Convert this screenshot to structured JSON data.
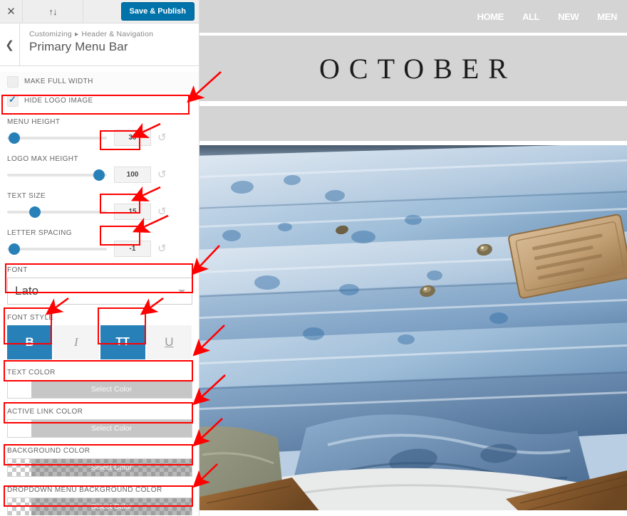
{
  "toolbar": {
    "close_icon": "close-x-icon",
    "devices_icon": "device-preview-icon",
    "save_label": "Save & Publish",
    "accent_color": "#0073aa"
  },
  "header": {
    "back_icon": "chevron-left-icon",
    "breadcrumb_root": "Customizing",
    "breadcrumb_separator": "▸",
    "breadcrumb_parent": "Header & Navigation",
    "title": "Primary Menu Bar"
  },
  "controls": {
    "make_full_width": {
      "label": "Make Full Width",
      "checked": false
    },
    "hide_logo_image": {
      "label": "Hide Logo Image",
      "checked": true
    },
    "menu_height": {
      "label": "Menu Height",
      "value": "30",
      "percent": 7
    },
    "logo_max_height": {
      "label": "Logo Max Height",
      "value": "100",
      "percent": 92
    },
    "text_size": {
      "label": "Text Size",
      "value": "15",
      "percent": 28
    },
    "letter_spacing": {
      "label": "Letter Spacing",
      "value": "-1",
      "percent": 7
    },
    "font": {
      "label": "Font",
      "value": "Lato"
    },
    "font_style": {
      "label": "Font Style",
      "buttons": [
        {
          "name": "bold",
          "glyph": "B",
          "active": true
        },
        {
          "name": "italic",
          "glyph": "I",
          "active": false
        },
        {
          "name": "uppercase",
          "glyph": "TT",
          "active": true
        },
        {
          "name": "underline",
          "glyph": "U",
          "active": false
        }
      ]
    },
    "text_color": {
      "label": "Text Color",
      "button_label": "Select Color",
      "swatch": "#ffffff",
      "transparent": false
    },
    "active_link_color": {
      "label": "Active Link Color",
      "button_label": "Select Color",
      "swatch": "#ffffff",
      "transparent": false
    },
    "background_color": {
      "label": "Background Color",
      "button_label": "Select Color",
      "transparent": true
    },
    "dropdown_menu_background_color": {
      "label": "Dropdown Menu Background Color",
      "button_label": "Select Color",
      "transparent": true
    },
    "reset_icon": "undo-reset-icon"
  },
  "preview": {
    "menu_items": [
      "HOME",
      "ALL",
      "NEW",
      "MEN"
    ],
    "logo_text": "OCTOBER",
    "navbar_color": "#d4d4d4",
    "menu_text_color": "#ffffff",
    "hero_alt": "folded-blue-denim-jeans-stack"
  },
  "annotations": {
    "highlight_color": "#ff0000",
    "arrow_color": "#ff0000",
    "highlighted_controls": [
      "hide_logo_image",
      "menu_height",
      "text_size",
      "letter_spacing",
      "font",
      "font_style_bold",
      "font_style_uppercase",
      "text_color",
      "active_link_color",
      "background_color",
      "dropdown_menu_background_color"
    ]
  }
}
